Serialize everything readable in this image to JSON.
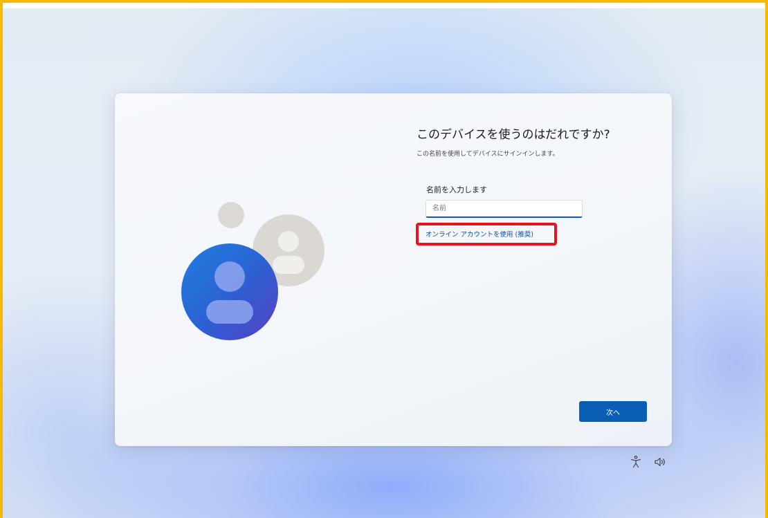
{
  "setup": {
    "title": "このデバイスを使うのはだれですか?",
    "subtitle": "この名前を使用してデバイスにサインインします。",
    "name_label": "名前を入力します",
    "name_input": {
      "placeholder": "名前",
      "value": ""
    },
    "online_account_link": "オンライン アカウントを使用 (推奨)",
    "next_label": "次へ"
  },
  "system_icons": [
    "accessibility-icon",
    "volume-icon"
  ],
  "colors": {
    "accent": "#0a5fb4",
    "highlight": "#e8141b",
    "frame": "#f7b900",
    "avatar_primary": "#2d6fd8",
    "avatar_secondary": "#d9d6d2"
  }
}
